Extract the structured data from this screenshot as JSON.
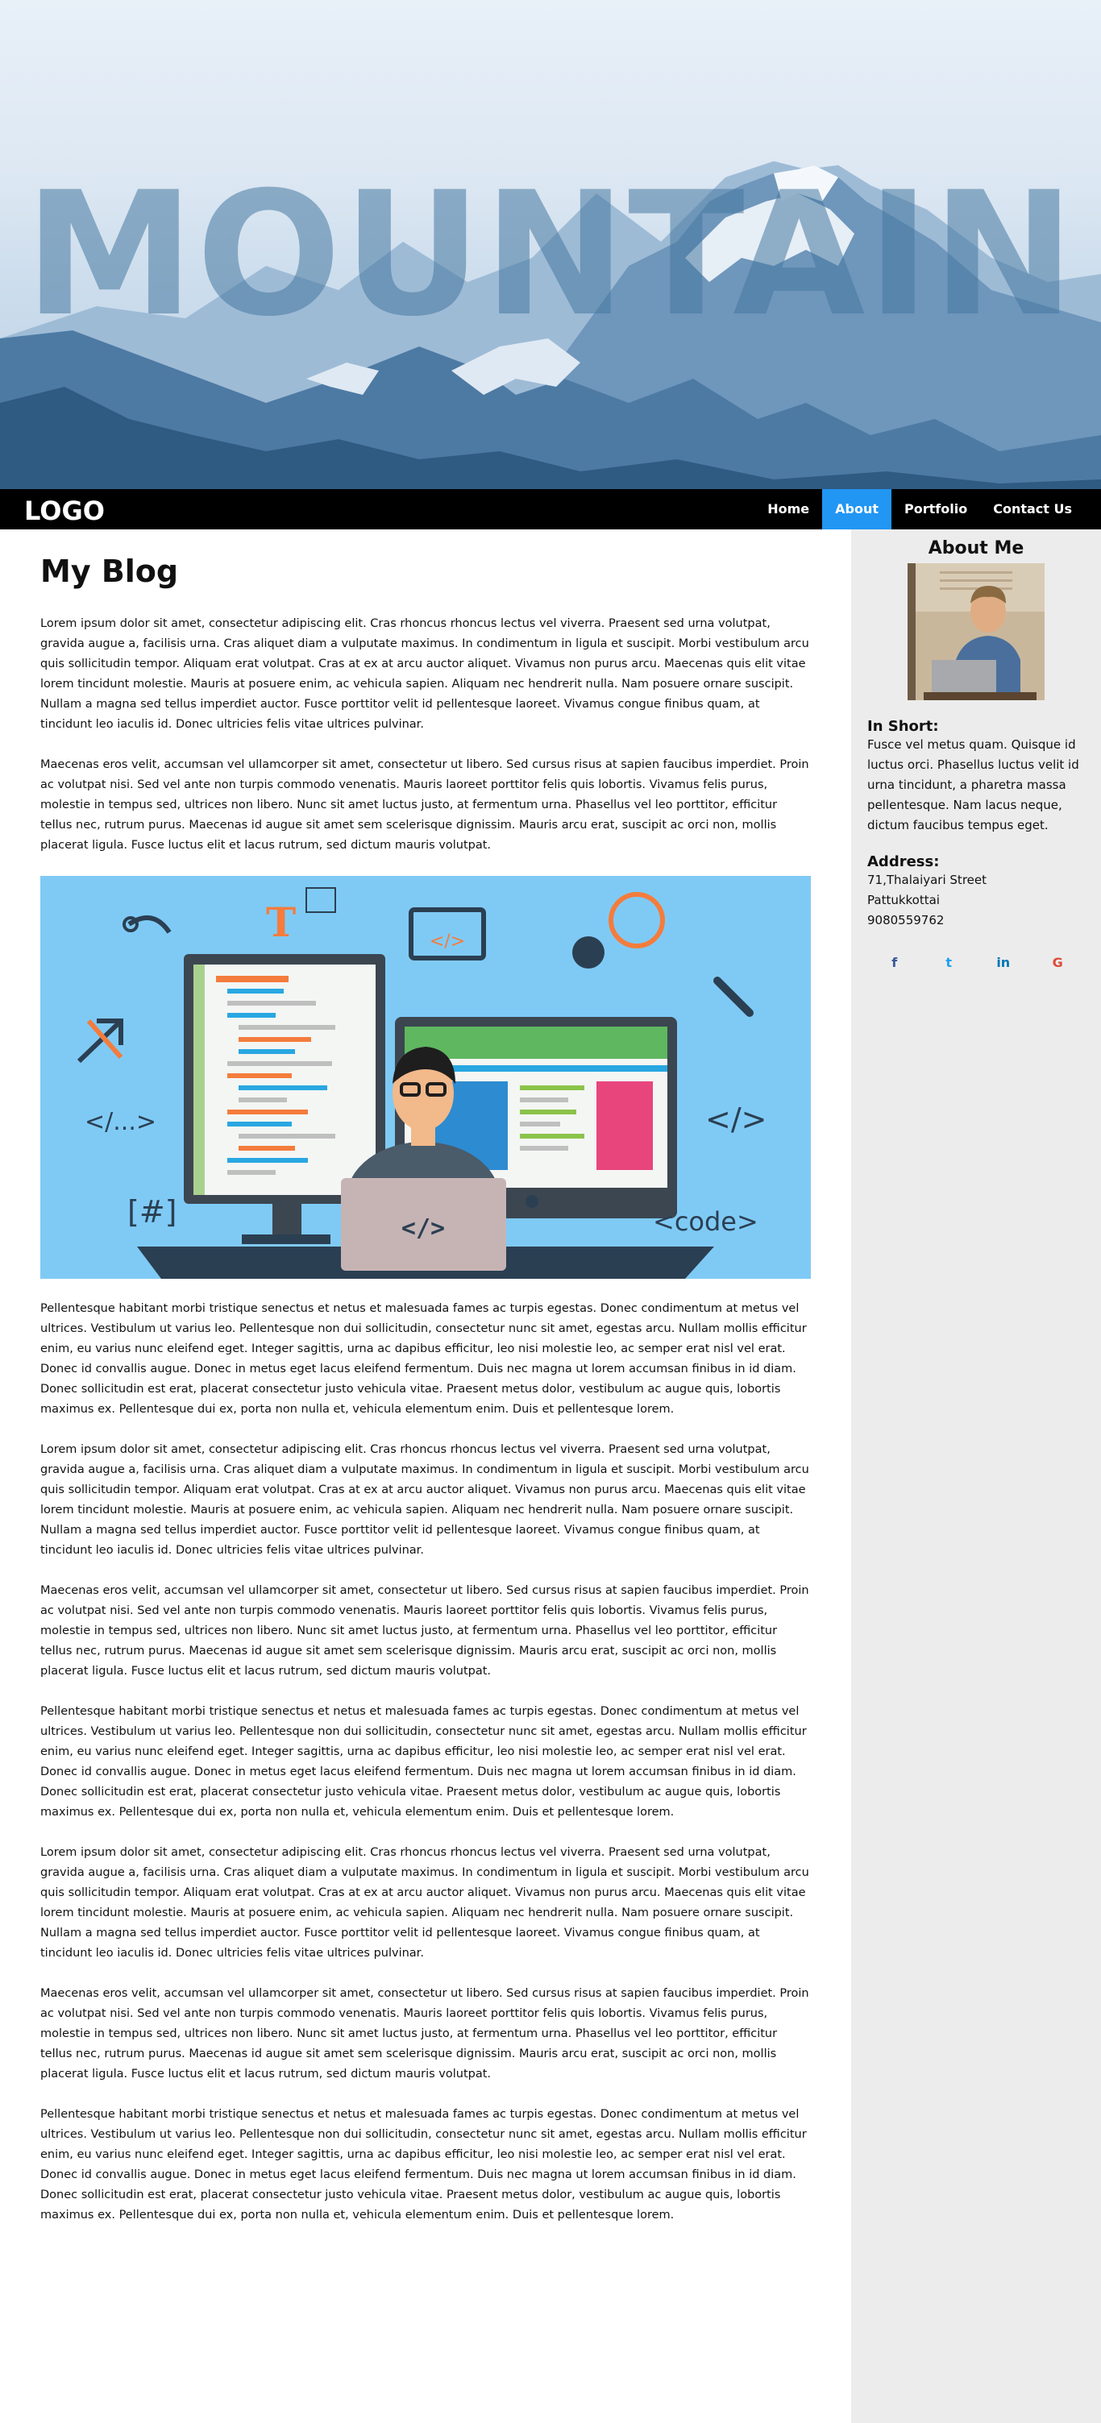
{
  "hero": {
    "title": "MOUNTAIN"
  },
  "nav": {
    "logo": "LOGO",
    "items": [
      {
        "label": "Home"
      },
      {
        "label": "About"
      },
      {
        "label": "Portfolio"
      },
      {
        "label": "Contact Us"
      }
    ]
  },
  "main": {
    "title": "My Blog",
    "paragraphs": [
      "Lorem ipsum dolor sit amet, consectetur adipiscing elit. Cras rhoncus rhoncus lectus vel viverra. Praesent sed urna volutpat, gravida augue a, facilisis urna. Cras aliquet diam a vulputate maximus. In condimentum in ligula et suscipit. Morbi vestibulum arcu quis sollicitudin tempor. Aliquam erat volutpat. Cras at ex at arcu auctor aliquet. Vivamus non purus arcu. Maecenas quis elit vitae lorem tincidunt molestie. Mauris at posuere enim, ac vehicula sapien. Aliquam nec hendrerit nulla. Nam posuere ornare suscipit. Nullam a magna sed tellus imperdiet auctor. Fusce porttitor velit id pellentesque laoreet. Vivamus congue finibus quam, at tincidunt leo iaculis id. Donec ultricies felis vitae ultrices pulvinar.",
      "Maecenas eros velit, accumsan vel ullamcorper sit amet, consectetur ut libero. Sed cursus risus at sapien faucibus imperdiet. Proin ac volutpat nisi. Sed vel ante non turpis commodo venenatis. Mauris laoreet porttitor felis quis lobortis. Vivamus felis purus, molestie in tempus sed, ultrices non libero. Nunc sit amet luctus justo, at fermentum urna. Phasellus vel leo porttitor, efficitur tellus nec, rutrum purus. Maecenas id augue sit amet sem scelerisque dignissim. Mauris arcu erat, suscipit ac orci non, mollis placerat ligula. Fusce luctus elit et lacus rutrum, sed dictum mauris volutpat.",
      "Pellentesque habitant morbi tristique senectus et netus et malesuada fames ac turpis egestas. Donec condimentum at metus vel ultrices. Vestibulum ut varius leo. Pellentesque non dui sollicitudin, consectetur nunc sit amet, egestas arcu. Nullam mollis efficitur enim, eu varius nunc eleifend eget. Integer sagittis, urna ac dapibus efficitur, leo nisi molestie leo, ac semper erat nisl vel erat. Donec id convallis augue. Donec in metus eget lacus eleifend fermentum. Duis nec magna ut lorem accumsan finibus in id diam. Donec sollicitudin est erat, placerat consectetur justo vehicula vitae. Praesent metus dolor, vestibulum ac augue quis, lobortis maximus ex. Pellentesque dui ex, porta non nulla et, vehicula elementum enim. Duis et pellentesque lorem."
    ],
    "image_labels": {
      "tag_dots": "</...>",
      "tag_close": "</>",
      "hash": "[#]",
      "code_word": "<code>",
      "laptop_code": "</>",
      "screen_code": "</>",
      "t_letter": "T"
    }
  },
  "sidebar": {
    "title": "About Me",
    "in_short_heading": "In Short:",
    "in_short_text": "Fusce vel metus quam. Quisque id luctus orci. Phasellus luctus velit id urna tincidunt, a pharetra massa pellentesque. Nam lacus neque, dictum faucibus tempus eget.",
    "address_heading": "Address:",
    "address_lines": [
      "71,Thalaiyari Street",
      "Pattukkottai",
      "9080559762"
    ],
    "socials": [
      {
        "label": "f",
        "icon": "facebook-icon",
        "color": "#3b5998"
      },
      {
        "label": "t",
        "icon": "twitter-icon",
        "color": "#1da1f2"
      },
      {
        "label": "in",
        "icon": "linkedin-icon",
        "color": "#0077b5"
      },
      {
        "label": "G",
        "icon": "google-icon",
        "color": "#dd4b39"
      }
    ]
  },
  "colors": {
    "accent": "#2196f3",
    "nav_bg": "#000000",
    "sidebar_bg": "#ececec"
  }
}
